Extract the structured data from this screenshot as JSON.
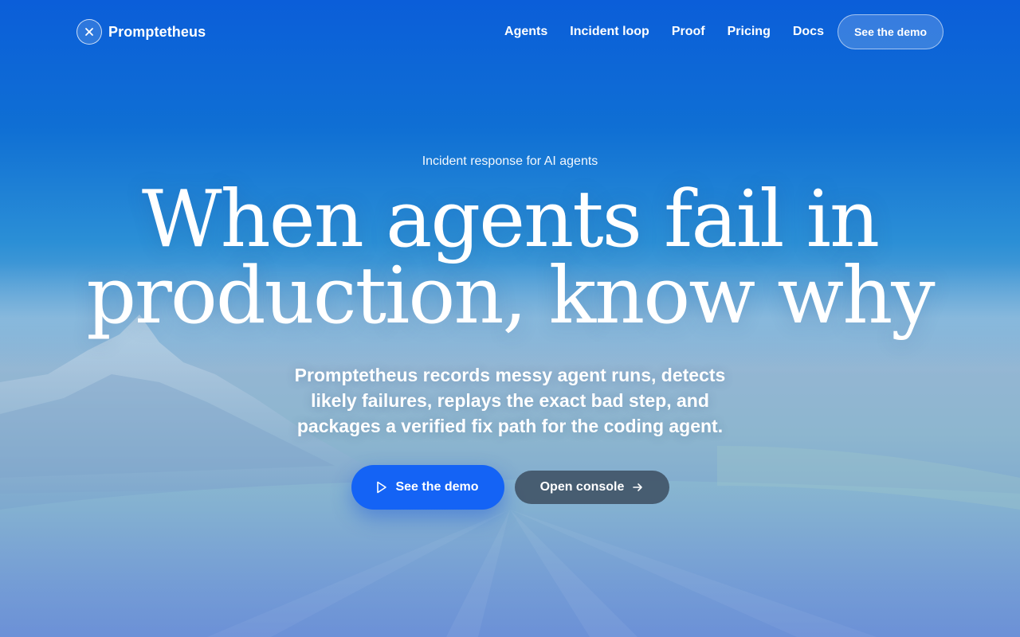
{
  "brand": {
    "name": "Promptetheus",
    "logo_icon": "sparkle-icon"
  },
  "nav": {
    "links": [
      "Agents",
      "Incident loop",
      "Proof",
      "Pricing",
      "Docs"
    ],
    "cta_label": "See the demo"
  },
  "hero": {
    "eyebrow": "Incident response for AI agents",
    "headline_line1": "When agents fail in",
    "headline_line2": "production, know why",
    "subtitle": "Promptetheus records messy agent runs, detects likely failures, replays the exact bad step, and packages a verified fix path for the coding agent.",
    "primary_button": {
      "label": "See the demo",
      "icon": "play-icon"
    },
    "secondary_button": {
      "label": "Open console",
      "icon": "arrow-right-icon"
    }
  },
  "colors": {
    "primary_button": "#1463f5",
    "secondary_button": "#3c4e60",
    "sky_top": "#0b5ed9"
  }
}
